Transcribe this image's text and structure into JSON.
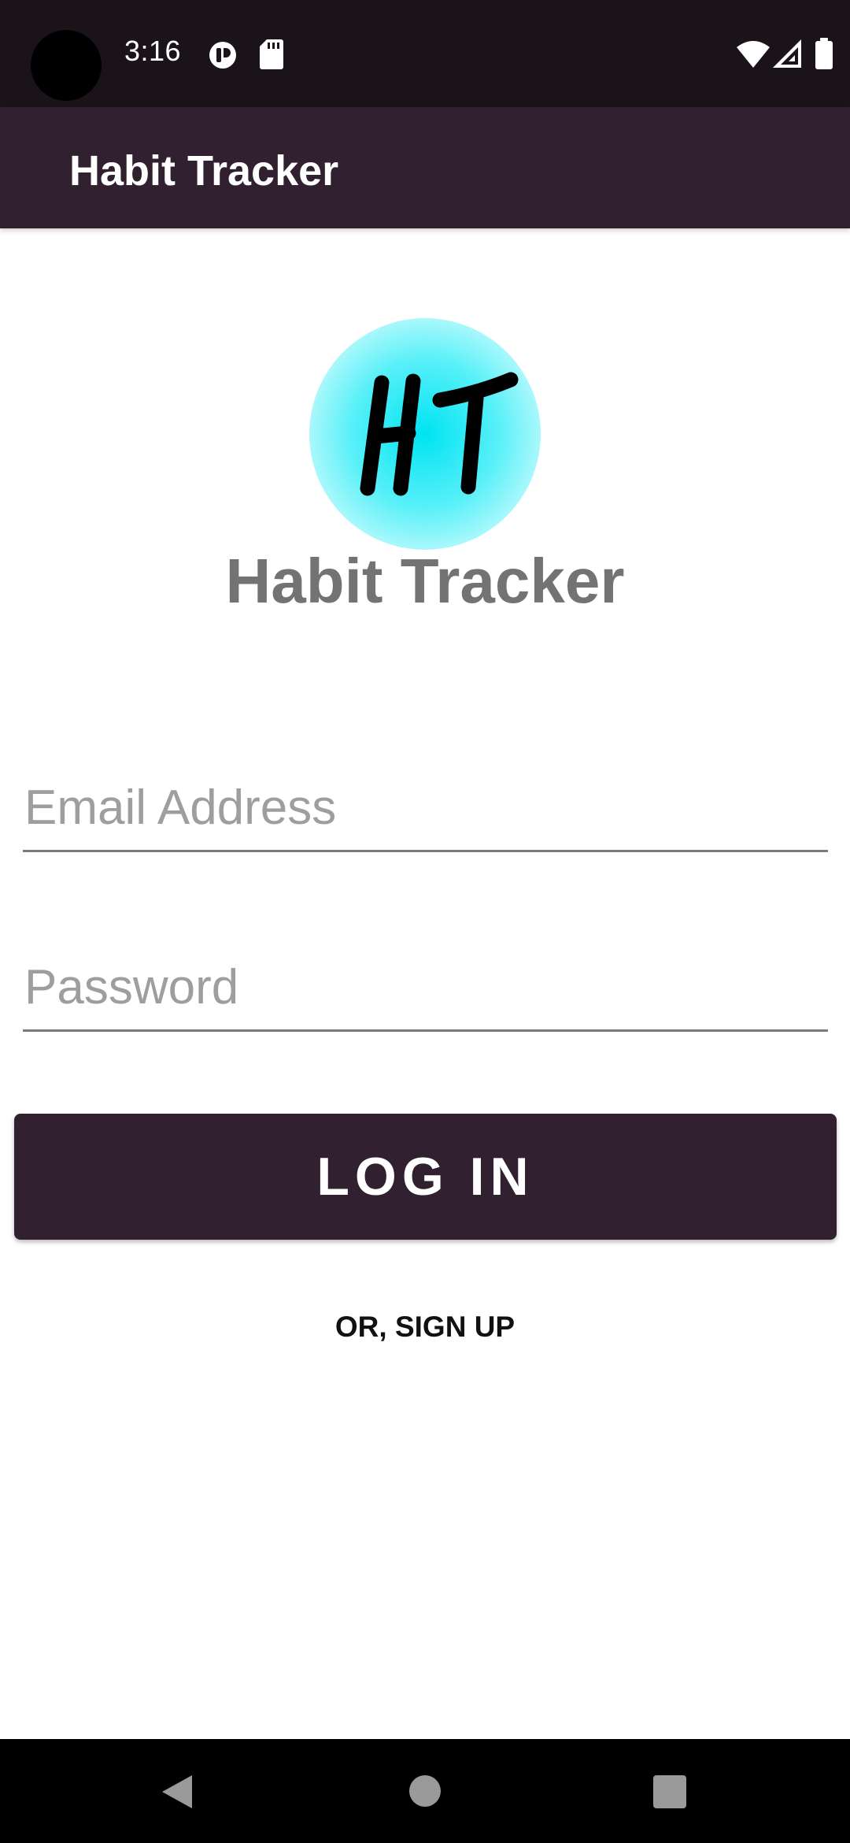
{
  "status_bar": {
    "time": "3:16",
    "icons": [
      "camera-cutout",
      "notification-icon",
      "sd-card-icon",
      "wifi-icon",
      "signal-icon",
      "battery-icon"
    ]
  },
  "app_bar": {
    "title": "Habit Tracker"
  },
  "logo": {
    "mark_text": "HT",
    "brand_name": "Habit Tracker",
    "colors": {
      "center": "#00e3f2",
      "edge": "#e4fdfe"
    }
  },
  "form": {
    "email_placeholder": "Email Address",
    "password_placeholder": "Password",
    "login_label": "LOG IN",
    "signup_label": "OR, SIGN UP"
  },
  "nav_bar": {
    "icons": [
      "back-icon",
      "home-icon",
      "recents-icon"
    ]
  },
  "colors": {
    "primary": "#31202f",
    "status_bar": "#1a1319",
    "brand_text": "#737373",
    "nav_bar": "#000000"
  }
}
